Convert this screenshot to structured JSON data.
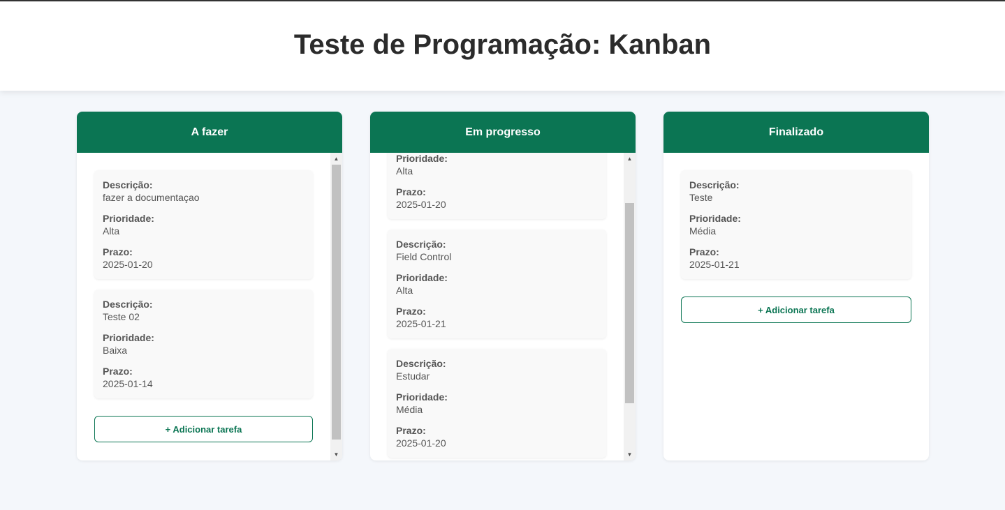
{
  "header": {
    "title": "Teste de Programação: Kanban"
  },
  "labels": {
    "description": "Descrição:",
    "priority": "Prioridade:",
    "deadline": "Prazo:"
  },
  "add_task_label": "+ Adicionar tarefa",
  "columns": [
    {
      "title": "A fazer",
      "cards": [
        {
          "description": "fazer a documentaçao",
          "priority": "Alta",
          "deadline": "2025-01-20"
        },
        {
          "description": "Teste 02",
          "priority": "Baixa",
          "deadline": "2025-01-14"
        }
      ]
    },
    {
      "title": "Em progresso",
      "cards": [
        {
          "description": "",
          "priority": "Alta",
          "deadline": "2025-01-20"
        },
        {
          "description": "Field Control",
          "priority": "Alta",
          "deadline": "2025-01-21"
        },
        {
          "description": "Estudar",
          "priority": "Média",
          "deadline": "2025-01-20"
        }
      ]
    },
    {
      "title": "Finalizado",
      "cards": [
        {
          "description": "Teste",
          "priority": "Média",
          "deadline": "2025-01-21"
        }
      ]
    }
  ],
  "colors": {
    "accent": "#0b7553",
    "background": "#f4f7fb",
    "card": "#f9f9f9"
  }
}
